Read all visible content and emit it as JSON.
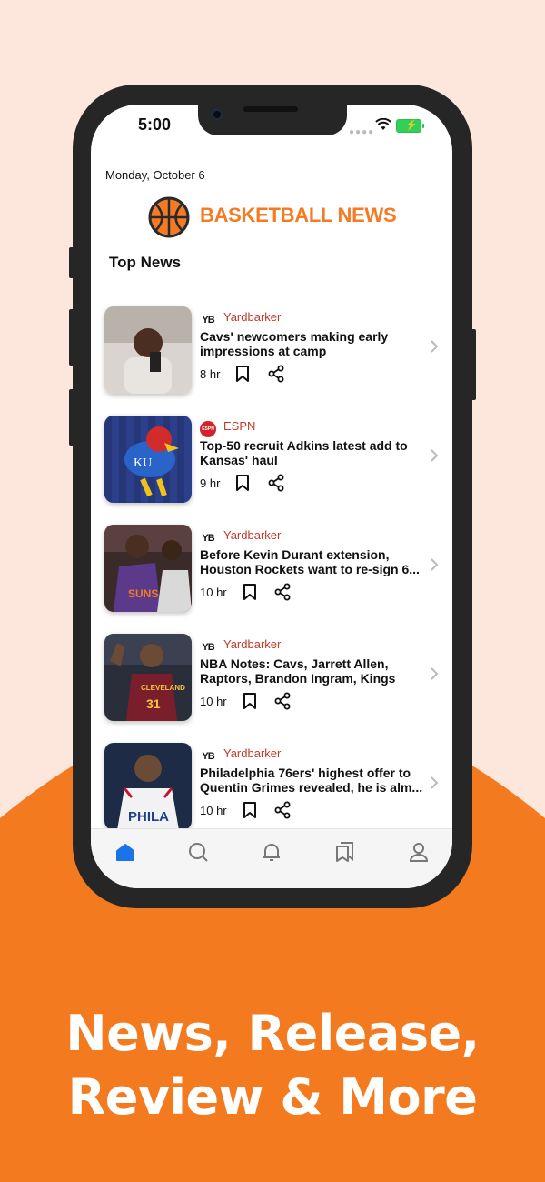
{
  "colors": {
    "accent": "#f47a23",
    "source_red": "#c0392b",
    "background_peach": "#fde7dc"
  },
  "status_bar": {
    "time": "5:00"
  },
  "header": {
    "date": "Monday, October 6",
    "brand": "BASKETBALL NEWS",
    "logo_icon": "basketball-icon"
  },
  "section_title": "Top News",
  "articles": [
    {
      "source": "Yardbarker",
      "source_icon": "YB",
      "headline": "Cavs' newcomers making early impressions at camp",
      "age": "8 hr"
    },
    {
      "source": "ESPN",
      "source_icon": "ESPN",
      "headline": "Top-50 recruit Adkins latest add to Kansas' haul",
      "age": "9 hr"
    },
    {
      "source": "Yardbarker",
      "source_icon": "YB",
      "headline": "Before Kevin Durant extension, Houston Rockets want to re-sign 6...",
      "age": "10 hr"
    },
    {
      "source": "Yardbarker",
      "source_icon": "YB",
      "headline": "NBA Notes: Cavs, Jarrett Allen, Raptors, Brandon Ingram, Kings",
      "age": "10 hr"
    },
    {
      "source": "Yardbarker",
      "source_icon": "YB",
      "headline": "Philadelphia 76ers' highest offer to Quentin Grimes revealed, he is alm...",
      "age": "10 hr"
    }
  ],
  "tabbar": [
    "home-icon",
    "search-icon",
    "bell-icon",
    "bookmarks-icon",
    "profile-icon"
  ],
  "tagline": {
    "line1": "News, Release,",
    "line2": "Review & More"
  }
}
